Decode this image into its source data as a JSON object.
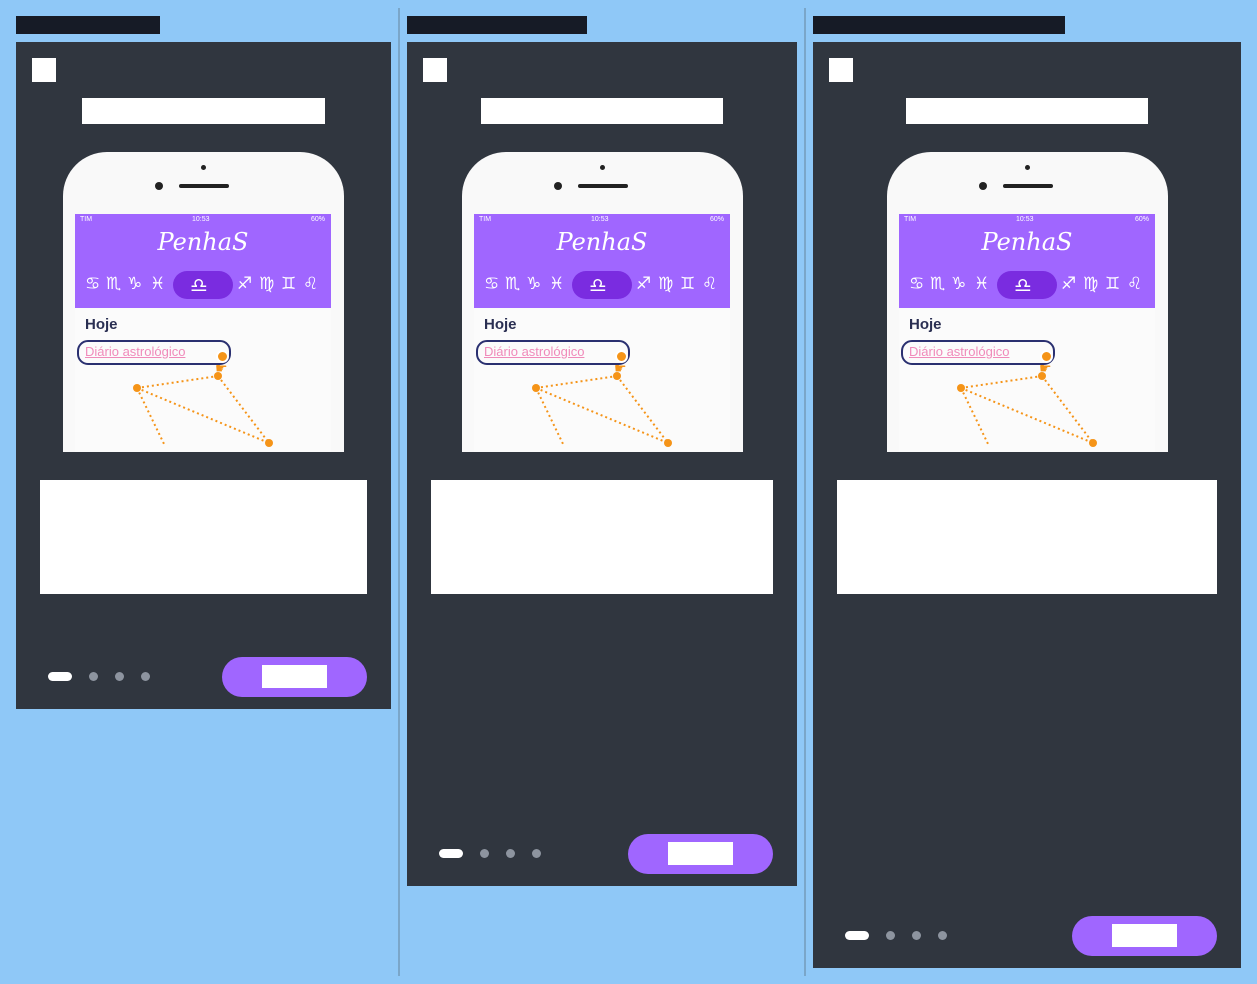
{
  "panels": [
    {
      "phone": {
        "status": {
          "carrier": "TIM",
          "time": "10:53",
          "battery": "60%"
        },
        "app_title": "PenhaS",
        "signs_left": [
          "♋",
          "♏",
          "♑",
          "♓"
        ],
        "sign_active": "♎",
        "signs_right": [
          "♐",
          "♍",
          "♊",
          "♌"
        ],
        "section_label": "Hoje",
        "link_label": "Diário astrológico"
      },
      "pagination": {
        "count": 4,
        "active": 1
      }
    },
    {
      "phone": {
        "status": {
          "carrier": "TIM",
          "time": "10:53",
          "battery": "60%"
        },
        "app_title": "PenhaS",
        "signs_left": [
          "♋",
          "♏",
          "♑",
          "♓"
        ],
        "sign_active": "♎",
        "signs_right": [
          "♐",
          "♍",
          "♊",
          "♌"
        ],
        "section_label": "Hoje",
        "link_label": "Diário astrológico"
      },
      "pagination": {
        "count": 4,
        "active": 1
      }
    },
    {
      "phone": {
        "status": {
          "carrier": "TIM",
          "time": "10:53",
          "battery": "60%"
        },
        "app_title": "PenhaS",
        "signs_left": [
          "♋",
          "♏",
          "♑",
          "♓"
        ],
        "sign_active": "♎",
        "signs_right": [
          "♐",
          "♍",
          "♊",
          "♌"
        ],
        "section_label": "Hoje",
        "link_label": "Diário astrológico"
      },
      "pagination": {
        "count": 4,
        "active": 1
      }
    }
  ],
  "colors": {
    "background": "#8fc8f7",
    "panel": "#30363f",
    "titlebar": "#161b26",
    "accent": "#a066ff",
    "accent_dark": "#7a2ce0",
    "link": "#f08aba",
    "tap_marker": "#f59418"
  },
  "icons": [
    "close-icon",
    "pointer-hand-icon",
    "constellation-icon"
  ]
}
